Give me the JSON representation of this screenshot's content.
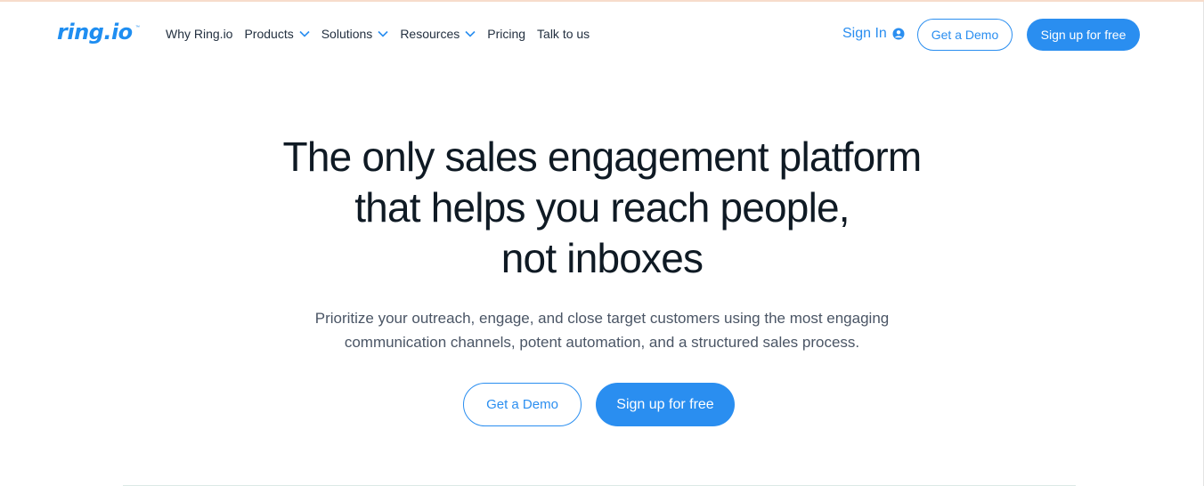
{
  "brand": {
    "logo_text": "ring.io",
    "logo_mark": "™"
  },
  "nav": {
    "items": [
      {
        "label": "Why Ring.io",
        "has_dropdown": false
      },
      {
        "label": "Products",
        "has_dropdown": true
      },
      {
        "label": "Solutions",
        "has_dropdown": true
      },
      {
        "label": "Resources",
        "has_dropdown": true
      },
      {
        "label": "Pricing",
        "has_dropdown": false
      },
      {
        "label": "Talk to us",
        "has_dropdown": false
      }
    ],
    "dropdown_icon": "chevron-down-icon"
  },
  "header_actions": {
    "sign_in_label": "Sign In",
    "sign_in_icon": "user-circle-icon",
    "demo_label": "Get a Demo",
    "signup_label": "Sign up for free"
  },
  "hero": {
    "title_lines": [
      "The only sales engagement platform",
      "that helps you reach people,",
      "not inboxes"
    ],
    "subtitle_lines": [
      "Prioritize your outreach, engage, and close target customers using the most engaging",
      "communication channels, potent automation, and a structured sales process."
    ],
    "demo_label": "Get a Demo",
    "signup_label": "Sign up for free"
  },
  "colors": {
    "accent": "#2a8ef0",
    "logo": "#1f8ef1",
    "heading": "#0f1a24",
    "body_text": "#4a5565",
    "nav_text": "#233040"
  }
}
